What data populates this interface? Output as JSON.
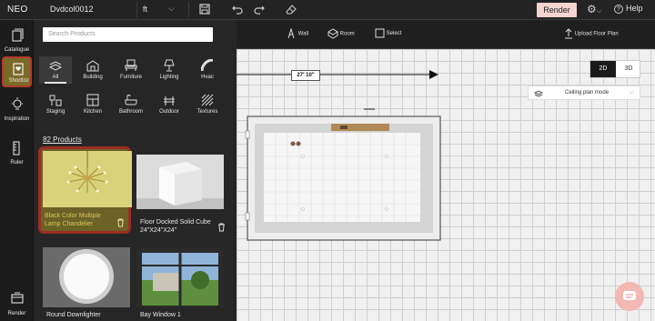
{
  "app": {
    "brand": "NEO",
    "document_title": "Dvdcol0012"
  },
  "topbar": {
    "unit": "ft",
    "render_label": "Render",
    "help_label": "Help"
  },
  "sidebar": {
    "items": [
      {
        "label": "Catalogue"
      },
      {
        "label": "Shortlist",
        "active": true
      },
      {
        "label": "Inspiration"
      },
      {
        "label": "Ruler"
      },
      {
        "label": "Render"
      }
    ]
  },
  "catalogue": {
    "search_placeholder": "Search Products",
    "categories": [
      {
        "label": "All",
        "selected": true
      },
      {
        "label": "Building"
      },
      {
        "label": "Furniture"
      },
      {
        "label": "Lighting"
      },
      {
        "label": "Hvac"
      },
      {
        "label": "Staging"
      },
      {
        "label": "Kitchen"
      },
      {
        "label": "Bathroom"
      },
      {
        "label": "Outdoor"
      },
      {
        "label": "Textures"
      }
    ],
    "product_count": "82 Products",
    "products": [
      {
        "name": "Black Color Multiple Lamp Chandelier",
        "selected": true
      },
      {
        "name": "Floor Docked Solid Cube 24\"X24\"X24\""
      },
      {
        "name": "Round Downlighter"
      },
      {
        "name": "Bay Window 1"
      }
    ]
  },
  "toolbar": {
    "wall_label": "Wall",
    "room_label": "Room",
    "select_label": "Select",
    "upload_label": "Upload Floor Plan"
  },
  "canvas": {
    "view_2d": "2D",
    "view_3d": "3D",
    "active_view": "2D",
    "mode_label": "Ceiling plan mode",
    "dimension_label": "27' 10\""
  },
  "colors": {
    "accent": "#f5d5d2",
    "selection_border": "#9b2d23",
    "active_bg": "#7a6a28"
  }
}
